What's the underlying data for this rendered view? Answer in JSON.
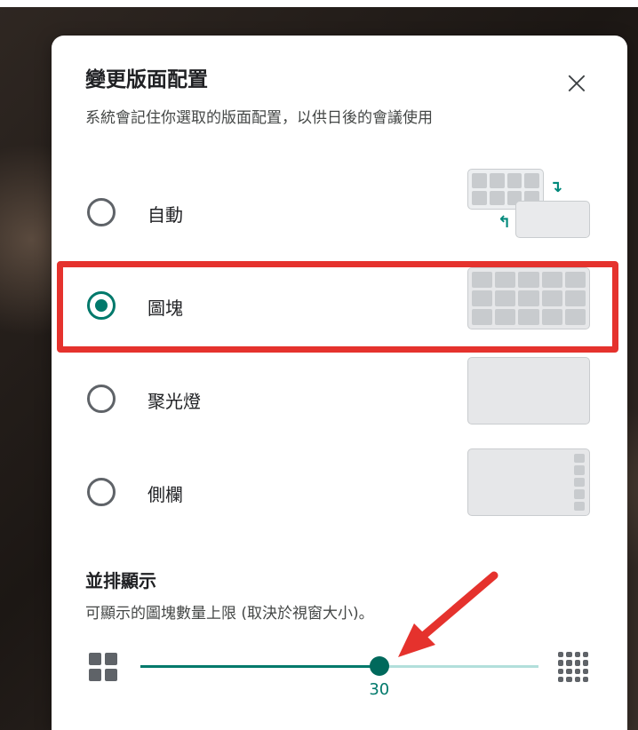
{
  "dialog": {
    "title": "變更版面配置",
    "subtitle": "系統會記住你選取的版面配置，以供日後的會議使用",
    "close_icon": "close-icon"
  },
  "layout_options": [
    {
      "label": "自動",
      "selected": false,
      "preview": "auto-layout-icon"
    },
    {
      "label": "圖塊",
      "selected": true,
      "preview": "tiled-layout-icon"
    },
    {
      "label": "聚光燈",
      "selected": false,
      "preview": "spotlight-layout-icon"
    },
    {
      "label": "側欄",
      "selected": false,
      "preview": "sidebar-layout-icon"
    }
  ],
  "tiles": {
    "title": "並排顯示",
    "description": "可顯示的圖塊數量上限 (取決於視窗大小)。",
    "slider": {
      "value": "30",
      "fraction": 0.6,
      "min_icon": "grid-small-icon",
      "max_icon": "grid-large-icon"
    }
  },
  "colors": {
    "accent": "#00796b",
    "highlight": "#e5322d"
  }
}
